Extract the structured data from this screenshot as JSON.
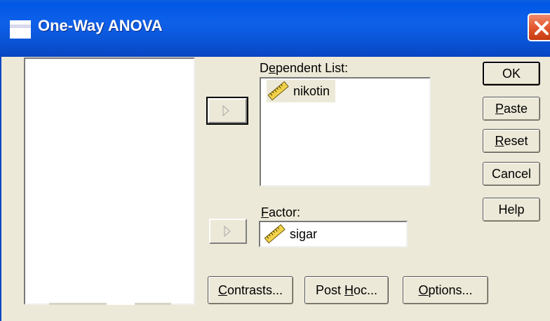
{
  "window": {
    "title": "One-Way ANOVA",
    "titlebar_color": "#0a5fe0",
    "close_color": "#e2582e"
  },
  "source_list": {
    "items": []
  },
  "dependent_list": {
    "label_pre": "D",
    "label_ul": "e",
    "label_post": "pendent List:",
    "items": [
      {
        "name": "nikotin",
        "icon": "scale-ruler-icon"
      }
    ]
  },
  "factor": {
    "label_ul": "F",
    "label_post": "actor:",
    "value": "sigar",
    "icon": "scale-ruler-icon"
  },
  "buttons": {
    "ok": "OK",
    "paste_ul": "P",
    "paste_rest": "aste",
    "reset_ul": "R",
    "reset_rest": "eset",
    "cancel": "Cancel",
    "help": "Help",
    "contrasts_ul": "C",
    "contrasts_rest": "ontrasts...",
    "posthoc_pre": "Post ",
    "posthoc_ul": "H",
    "posthoc_rest": "oc...",
    "options_ul": "O",
    "options_rest": "ptions..."
  }
}
